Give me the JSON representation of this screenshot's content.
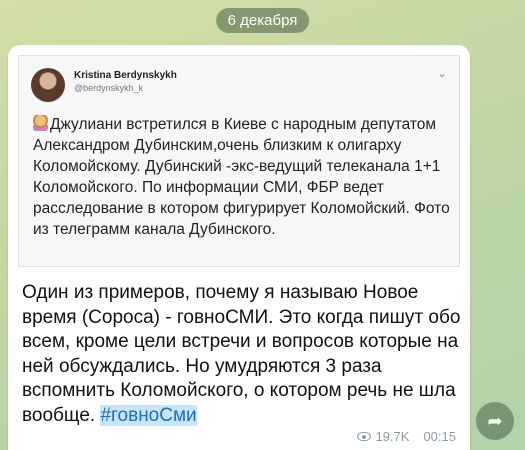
{
  "date_label": "6 декабря",
  "embedded_tweet": {
    "author_name": "Kristina Berdynskykh",
    "author_handle": "@berdynskykh_k",
    "text": "Джулиани встретился в Киеве с народным депутатом Александром Дубинским,очень близким к олигарху Коломойскому. Дубинский -экс-ведущий телеканала 1+1 Коломойского. По информации СМИ, ФБР ведет расследование в котором фигурирует Коломойский. Фото из телеграмм канала Дубинского."
  },
  "message": {
    "text": "Один из примеров, почему я называю Новое время (Сороса) - говноСМИ. Это когда пишут обо всем, кроме цели встречи и вопросов которые на ней обсуждались. Но умудряются 3 раза вспомнить Коломойского, о котором речь не шла вообще. ",
    "hashtag": "#говноСми",
    "views": "19.7K",
    "time": "00:15"
  },
  "colors": {
    "hashtag_bg": "#c8e4f7",
    "hashtag_text": "#1f6fb3",
    "meta": "#8a9aa8"
  },
  "icons": {
    "views": "eye-icon",
    "share": "share-arrow-icon",
    "menu": "chevron-down-icon"
  }
}
